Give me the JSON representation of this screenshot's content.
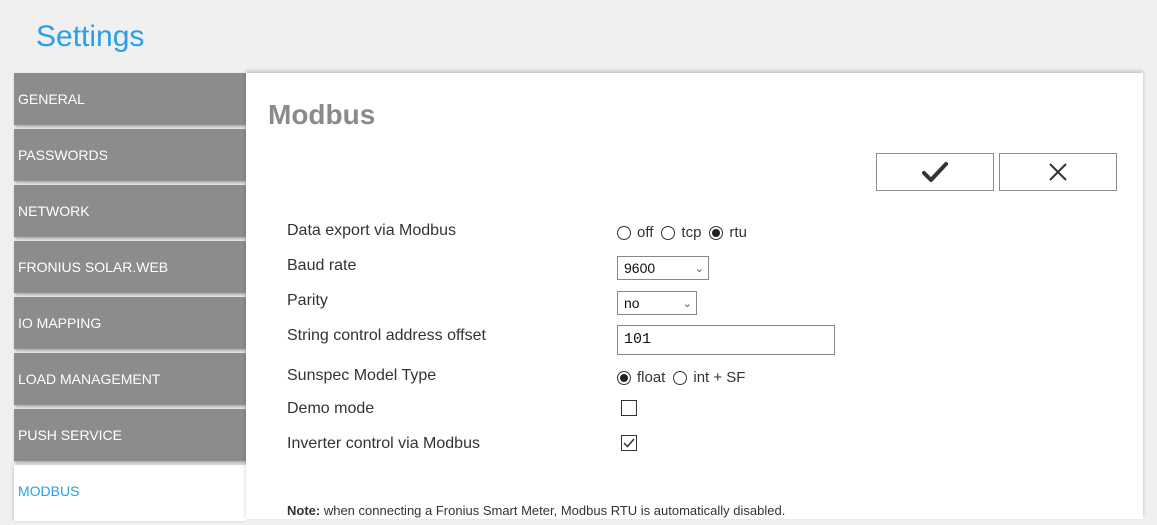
{
  "page": {
    "title": "Settings"
  },
  "sidebar": {
    "items": [
      {
        "label": "GENERAL"
      },
      {
        "label": "PASSWORDS"
      },
      {
        "label": "NETWORK"
      },
      {
        "label": "FRONIUS SOLAR.WEB"
      },
      {
        "label": "IO MAPPING"
      },
      {
        "label": "LOAD MANAGEMENT"
      },
      {
        "label": "PUSH SERVICE"
      },
      {
        "label": "MODBUS",
        "active": true
      }
    ]
  },
  "panel": {
    "title": "Modbus",
    "ok_icon": "check-icon",
    "cancel_icon": "close-icon"
  },
  "form": {
    "data_export": {
      "label": "Data export via Modbus",
      "options": [
        "off",
        "tcp",
        "rtu"
      ],
      "selected": "rtu"
    },
    "baud_rate": {
      "label": "Baud rate",
      "value": "9600"
    },
    "parity": {
      "label": "Parity",
      "value": "no"
    },
    "offset": {
      "label": "String control address offset",
      "value": "101"
    },
    "sunspec": {
      "label": "Sunspec Model Type",
      "options": [
        "float",
        "int + SF"
      ],
      "selected": "float"
    },
    "demo_mode": {
      "label": "Demo mode",
      "checked": false
    },
    "inverter_control": {
      "label": "Inverter control via Modbus",
      "checked": true
    }
  },
  "note": {
    "prefix": "Note:",
    "text": " when connecting a Fronius Smart Meter, Modbus RTU is automatically disabled."
  },
  "colors": {
    "accent": "#2a9fe8",
    "nav_bg": "#8c8c8c"
  }
}
